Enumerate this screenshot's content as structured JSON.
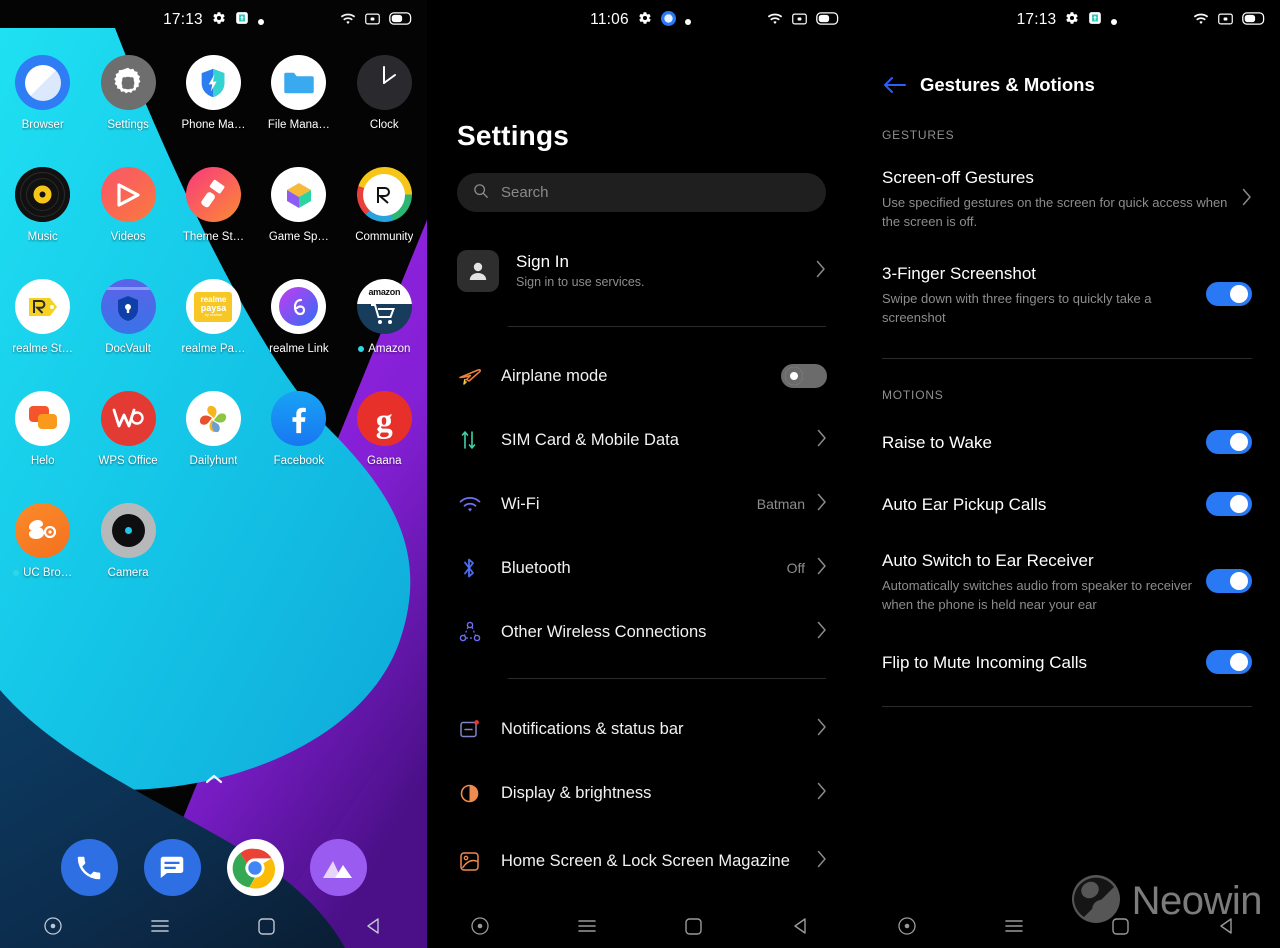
{
  "colors": {
    "accent_blue": "#2979f5",
    "wallpaper_cyan": "#17cbe8",
    "wallpaper_purple": "#8b25d8",
    "wallpaper_navy": "#0e3354",
    "toggle_on": "#2979f5",
    "toggle_off": "#6b6b6b",
    "subtext": "#8d8d8d"
  },
  "home": {
    "status": {
      "time": "17:13",
      "icons_left": [
        "gear-icon",
        "screenshot-icon",
        "dot-icon"
      ],
      "icons_right": [
        "wifi-icon",
        "cast-icon",
        "battery-icon"
      ]
    },
    "apps": [
      {
        "label": "Browser",
        "icon": "browser-icon",
        "badge": false
      },
      {
        "label": "Settings",
        "icon": "settings-icon",
        "badge": false
      },
      {
        "label": "Phone Ma…",
        "icon": "phone-manager-icon",
        "badge": false
      },
      {
        "label": "File Mana…",
        "icon": "file-manager-icon",
        "badge": false
      },
      {
        "label": "Clock",
        "icon": "clock-icon",
        "badge": false
      },
      {
        "label": "Music",
        "icon": "music-icon",
        "badge": false
      },
      {
        "label": "Videos",
        "icon": "videos-icon",
        "badge": false
      },
      {
        "label": "Theme St…",
        "icon": "theme-store-icon",
        "badge": false
      },
      {
        "label": "Game Sp…",
        "icon": "game-space-icon",
        "badge": false
      },
      {
        "label": "Community",
        "icon": "community-icon",
        "badge": false
      },
      {
        "label": "realme St…",
        "icon": "realme-store-icon",
        "badge": false
      },
      {
        "label": "DocVault",
        "icon": "docvault-icon",
        "badge": false
      },
      {
        "label": "realme Pa…",
        "icon": "realme-paysa-icon",
        "badge": false
      },
      {
        "label": "realme Link",
        "icon": "realme-link-icon",
        "badge": false
      },
      {
        "label": "Amazon",
        "icon": "amazon-icon",
        "badge": true
      },
      {
        "label": "Helo",
        "icon": "helo-icon",
        "badge": false
      },
      {
        "label": "WPS Office",
        "icon": "wps-office-icon",
        "badge": false
      },
      {
        "label": "Dailyhunt",
        "icon": "dailyhunt-icon",
        "badge": false
      },
      {
        "label": "Facebook",
        "icon": "facebook-icon",
        "badge": false
      },
      {
        "label": "Gaana",
        "icon": "gaana-icon",
        "badge": false
      },
      {
        "label": "UC Bro…",
        "icon": "uc-browser-icon",
        "badge": true
      },
      {
        "label": "Camera",
        "icon": "camera-icon",
        "badge": false
      }
    ],
    "dock": [
      {
        "label": "Phone",
        "icon": "phone-icon"
      },
      {
        "label": "Messages",
        "icon": "messages-icon"
      },
      {
        "label": "Chrome",
        "icon": "chrome-icon"
      },
      {
        "label": "Photos",
        "icon": "photos-icon"
      }
    ],
    "app_drawer_hint": "˄"
  },
  "settings": {
    "status": {
      "time": "11:06"
    },
    "title": "Settings",
    "search": {
      "placeholder": "Search",
      "value": ""
    },
    "account": {
      "title": "Sign In",
      "subtitle": "Sign in to use services."
    },
    "items": [
      {
        "label": "Airplane mode",
        "icon": "airplane-icon",
        "control": "toggle",
        "toggle": false,
        "value": ""
      },
      {
        "label": "SIM Card & Mobile Data",
        "icon": "sim-card-icon",
        "control": "chevron",
        "value": ""
      },
      {
        "label": "Wi-Fi",
        "icon": "wifi-icon",
        "control": "chevron",
        "value": "Batman"
      },
      {
        "label": "Bluetooth",
        "icon": "bluetooth-icon",
        "control": "chevron",
        "value": "Off"
      },
      {
        "label": "Other Wireless Connections",
        "icon": "wireless-icon",
        "control": "chevron",
        "value": ""
      },
      {
        "label": "Notifications & status bar",
        "icon": "notifications-icon",
        "control": "chevron",
        "value": ""
      },
      {
        "label": "Display & brightness",
        "icon": "display-icon",
        "control": "chevron",
        "value": ""
      },
      {
        "label": "Home Screen & Lock Screen Magazine",
        "icon": "home-lock-icon",
        "control": "chevron",
        "value": ""
      }
    ]
  },
  "gestures": {
    "status": {
      "time": "17:13"
    },
    "title": "Gestures & Motions",
    "back_icon": "back-arrow-icon",
    "sections": [
      {
        "heading": "GESTURES",
        "rows": [
          {
            "title": "Screen-off Gestures",
            "subtitle": "Use specified gestures on the screen for quick access when the screen is off.",
            "control": "chevron",
            "toggle": null
          },
          {
            "title": "3-Finger Screenshot",
            "subtitle": "Swipe down with three fingers to quickly take a screenshot",
            "control": "toggle",
            "toggle": true
          }
        ]
      },
      {
        "heading": "MOTIONS",
        "rows": [
          {
            "title": "Raise to Wake",
            "subtitle": "",
            "control": "toggle",
            "toggle": true
          },
          {
            "title": "Auto Ear Pickup Calls",
            "subtitle": "",
            "control": "toggle",
            "toggle": true
          },
          {
            "title": "Auto Switch to Ear Receiver",
            "subtitle": "Automatically switches audio from speaker to receiver when the phone is held near your ear",
            "control": "toggle",
            "toggle": true
          },
          {
            "title": "Flip to Mute Incoming Calls",
            "subtitle": "",
            "control": "toggle",
            "toggle": true
          }
        ]
      }
    ]
  },
  "navbar": {
    "buttons": [
      "assistant-icon",
      "menu-icon",
      "home-icon",
      "back-icon"
    ]
  },
  "watermark": {
    "text": "Neowin",
    "logo": "neowin-logo-icon"
  }
}
